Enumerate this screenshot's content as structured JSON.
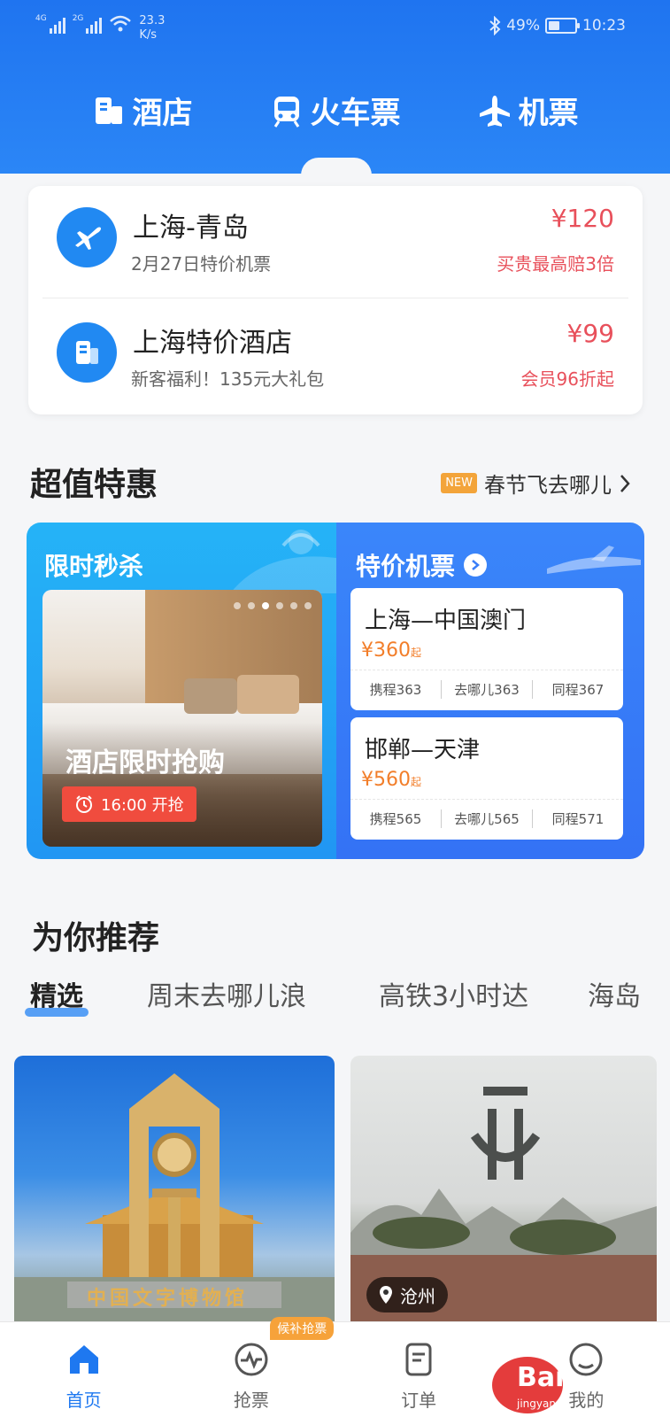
{
  "status_bar": {
    "net1": "4G",
    "net2": "2G",
    "speed_top": "23.3",
    "speed_bottom": "K/s",
    "battery_text": "49%",
    "battery_level": 0.49,
    "time": "10:23"
  },
  "top_nav": {
    "tabs": [
      {
        "label": "酒店",
        "icon": "hotel-icon"
      },
      {
        "label": "火车票",
        "icon": "train-icon"
      },
      {
        "label": "机票",
        "icon": "plane-icon"
      }
    ],
    "active_index": 1
  },
  "promo_card": {
    "items": [
      {
        "title": "上海-青岛",
        "subtitle": "2月27日特价机票",
        "price": "¥120",
        "note": "买贵最高赔3倍",
        "icon": "plane-icon"
      },
      {
        "title": "上海特价酒店",
        "subtitle": "新客福利！135元大礼包",
        "price": "¥99",
        "note": "会员96折起",
        "icon": "hotel-icon"
      }
    ]
  },
  "deals": {
    "title": "超值特惠",
    "link_badge": "NEW",
    "link_text": "春节飞去哪儿",
    "left": {
      "title": "限时秒杀",
      "caption": "酒店限时抢购",
      "time_button": "16:00 开抢",
      "carousel_dots": 6,
      "active_dot": 2
    },
    "right": {
      "title": "特价机票",
      "tickets": [
        {
          "route": "上海—中国澳门",
          "price": "¥360",
          "suffix": "起",
          "sources": [
            "携程363",
            "去哪儿363",
            "同程367"
          ]
        },
        {
          "route": "邯郸—天津",
          "price": "¥560",
          "suffix": "起",
          "sources": [
            "携程565",
            "去哪儿565",
            "同程571"
          ]
        }
      ]
    }
  },
  "recommend": {
    "title": "为你推荐",
    "tabs": [
      "精选",
      "周末去哪儿浪",
      "高铁3小时达",
      "海岛"
    ],
    "active_tab": 0,
    "cards": [
      {
        "image": "museum-photo",
        "photo_text": "中国文字博物馆"
      },
      {
        "image": "sculpture-photo",
        "location": "沧州"
      }
    ]
  },
  "bottom_nav": {
    "items": [
      {
        "label": "首页",
        "icon": "home-icon"
      },
      {
        "label": "抢票",
        "icon": "grab-ticket-icon"
      },
      {
        "label": "订单",
        "icon": "order-icon"
      },
      {
        "label": "我的",
        "icon": "profile-icon"
      }
    ],
    "active_index": 0,
    "badge": "候补抢票"
  },
  "watermark": {
    "brand": "Bai",
    "site": "jingyan"
  },
  "colors": {
    "primary": "#1e78f0",
    "price_red": "#e8505b",
    "price_orange": "#f27e2a",
    "badge_orange": "#f6a23a"
  }
}
